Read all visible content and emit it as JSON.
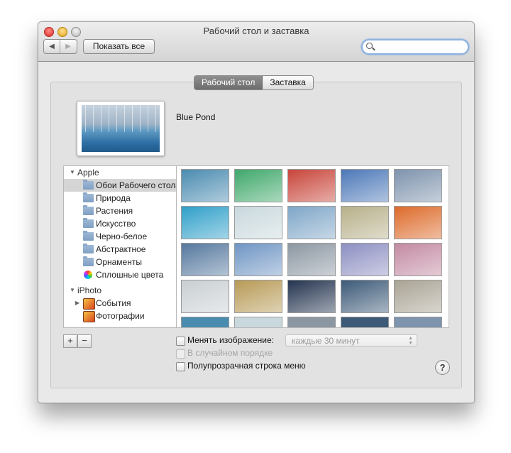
{
  "window": {
    "title": "Рабочий стол и заставка"
  },
  "toolbar": {
    "back_label": "◀",
    "forward_label": "▶",
    "show_all_label": "Показать все",
    "search_placeholder": ""
  },
  "tabs": [
    {
      "label": "Рабочий стол",
      "selected": true
    },
    {
      "label": "Заставка",
      "selected": false
    }
  ],
  "current_wallpaper": {
    "name": "Blue Pond"
  },
  "source_list": {
    "groups": [
      {
        "label": "Apple",
        "items": [
          "Обои Рабочего стола",
          "Природа",
          "Растения",
          "Искусство",
          "Черно-белое",
          "Абстрактное",
          "Орнаменты",
          "Сплошные цвета"
        ]
      },
      {
        "label": "iPhoto",
        "items": [
          "События",
          "Фотографии"
        ]
      }
    ],
    "selected": "Обои Рабочего стола"
  },
  "thumbnails": {
    "colors": [
      [
        "#4a8bb0",
        "#3fa86a",
        "#c8453a",
        "#4c78b8",
        "#7e93ad"
      ],
      [
        "#2f9fc9",
        "#c9d8dd",
        "#7fa6c8",
        "#b7b08a",
        "#dd6a2a"
      ],
      [
        "#55789e",
        "#6f95c4",
        "#8c97a2",
        "#8d8fc2",
        "#c38aa2"
      ],
      [
        "#c9cfd2",
        "#b79a56",
        "#24344f",
        "#3d5a78",
        "#a9a394"
      ]
    ]
  },
  "bottom": {
    "add_label": "+",
    "remove_label": "−",
    "change_picture_label": "Менять изображение:",
    "interval_value": "каждые 30 минут",
    "random_order_label": "В случайном порядке",
    "translucent_menu_label": "Полупрозрачная строка меню",
    "help_label": "?"
  }
}
